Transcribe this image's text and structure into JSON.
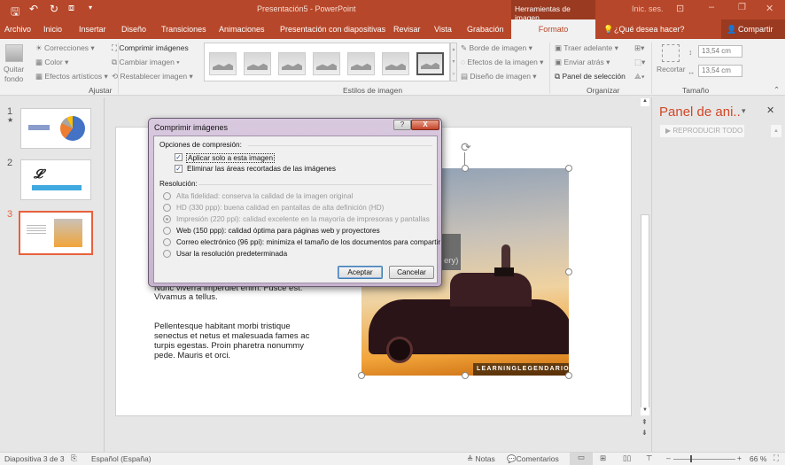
{
  "titlebar": {
    "title": "Presentación5 - PowerPoint",
    "context_tab": "Herramientas de imagen",
    "signin": "Inic. ses."
  },
  "tabs": [
    "Archivo",
    "Inicio",
    "Insertar",
    "Diseño",
    "Transiciones",
    "Animaciones",
    "Presentación con diapositivas",
    "Revisar",
    "Vista",
    "Grabación",
    "Formato"
  ],
  "tell_me": "¿Qué desea hacer?",
  "share": "Compartir",
  "ribbon": {
    "ajustar": {
      "quitar_fondo_1": "Quitar",
      "quitar_fondo_2": "fondo",
      "correcciones": "Correcciones",
      "color": "Color",
      "efectos": "Efectos artísticos",
      "comprimir": "Comprimir imágenes",
      "cambiar": "Cambiar imagen",
      "restablecer": "Restablecer imagen",
      "label": "Ajustar"
    },
    "estilos": {
      "borde": "Borde de imagen",
      "efectos": "Efectos de la imagen",
      "diseno": "Diseño de imagen",
      "label": "Estilos de imagen"
    },
    "organizar": {
      "traer": "Traer adelante",
      "enviar": "Enviar atrás",
      "panel": "Panel de selección",
      "label": "Organizar"
    },
    "tamano": {
      "recortar": "Recortar",
      "height": "13,54 cm",
      "width": "13,54 cm",
      "label": "Tamaño"
    }
  },
  "slides": [
    {
      "num": "1"
    },
    {
      "num": "2"
    },
    {
      "num": "3"
    }
  ],
  "slide": {
    "line_hidden": "Nunc viverra imperdiet enim. Fusce est.",
    "line1": "Vivamus a tellus.",
    "para": [
      "Pellentesque habitant morbi tristique",
      "senectus et netus et malesuada fames ac",
      "turpis egestas. Proin pharetra nonummy",
      "pede. Mauris et orci."
    ],
    "caption_fragment": "ery)",
    "watermark": "LEARNINGLEGENDARIO.COM"
  },
  "panel": {
    "title": "Panel de ani..",
    "play_all": "REPRODUCIR TODO"
  },
  "dialog": {
    "title": "Comprimir imágenes",
    "options_heading": "Opciones de compresión:",
    "opt_apply": "Aplicar solo a esta imagen",
    "opt_delete": "Eliminar las áreas recortadas de las imágenes",
    "resolution_heading": "Resolución:",
    "res": [
      "Alta fidelidad: conserva la calidad de la imagen original",
      "HD (330 ppp): buena calidad en pantallas de alta definición (HD)",
      "Impresión (220 ppi): calidad excelente en la mayoría de impresoras y pantallas",
      "Web (150 ppp): calidad óptima para páginas web y proyectores",
      "Correo electrónico (96 ppi): minimiza el tamaño de los documentos para compartir",
      "Usar la resolución predeterminada"
    ],
    "ok": "Aceptar",
    "cancel": "Cancelar",
    "help": "?",
    "close": "X"
  },
  "status": {
    "slide": "Diapositiva 3 de 3",
    "lang": "Español (España)",
    "notes": "Notas",
    "comments": "Comentarios",
    "zoom": "66 %"
  },
  "colors": {
    "accent": "#b7472a",
    "selected_slide": "#e8603c"
  }
}
